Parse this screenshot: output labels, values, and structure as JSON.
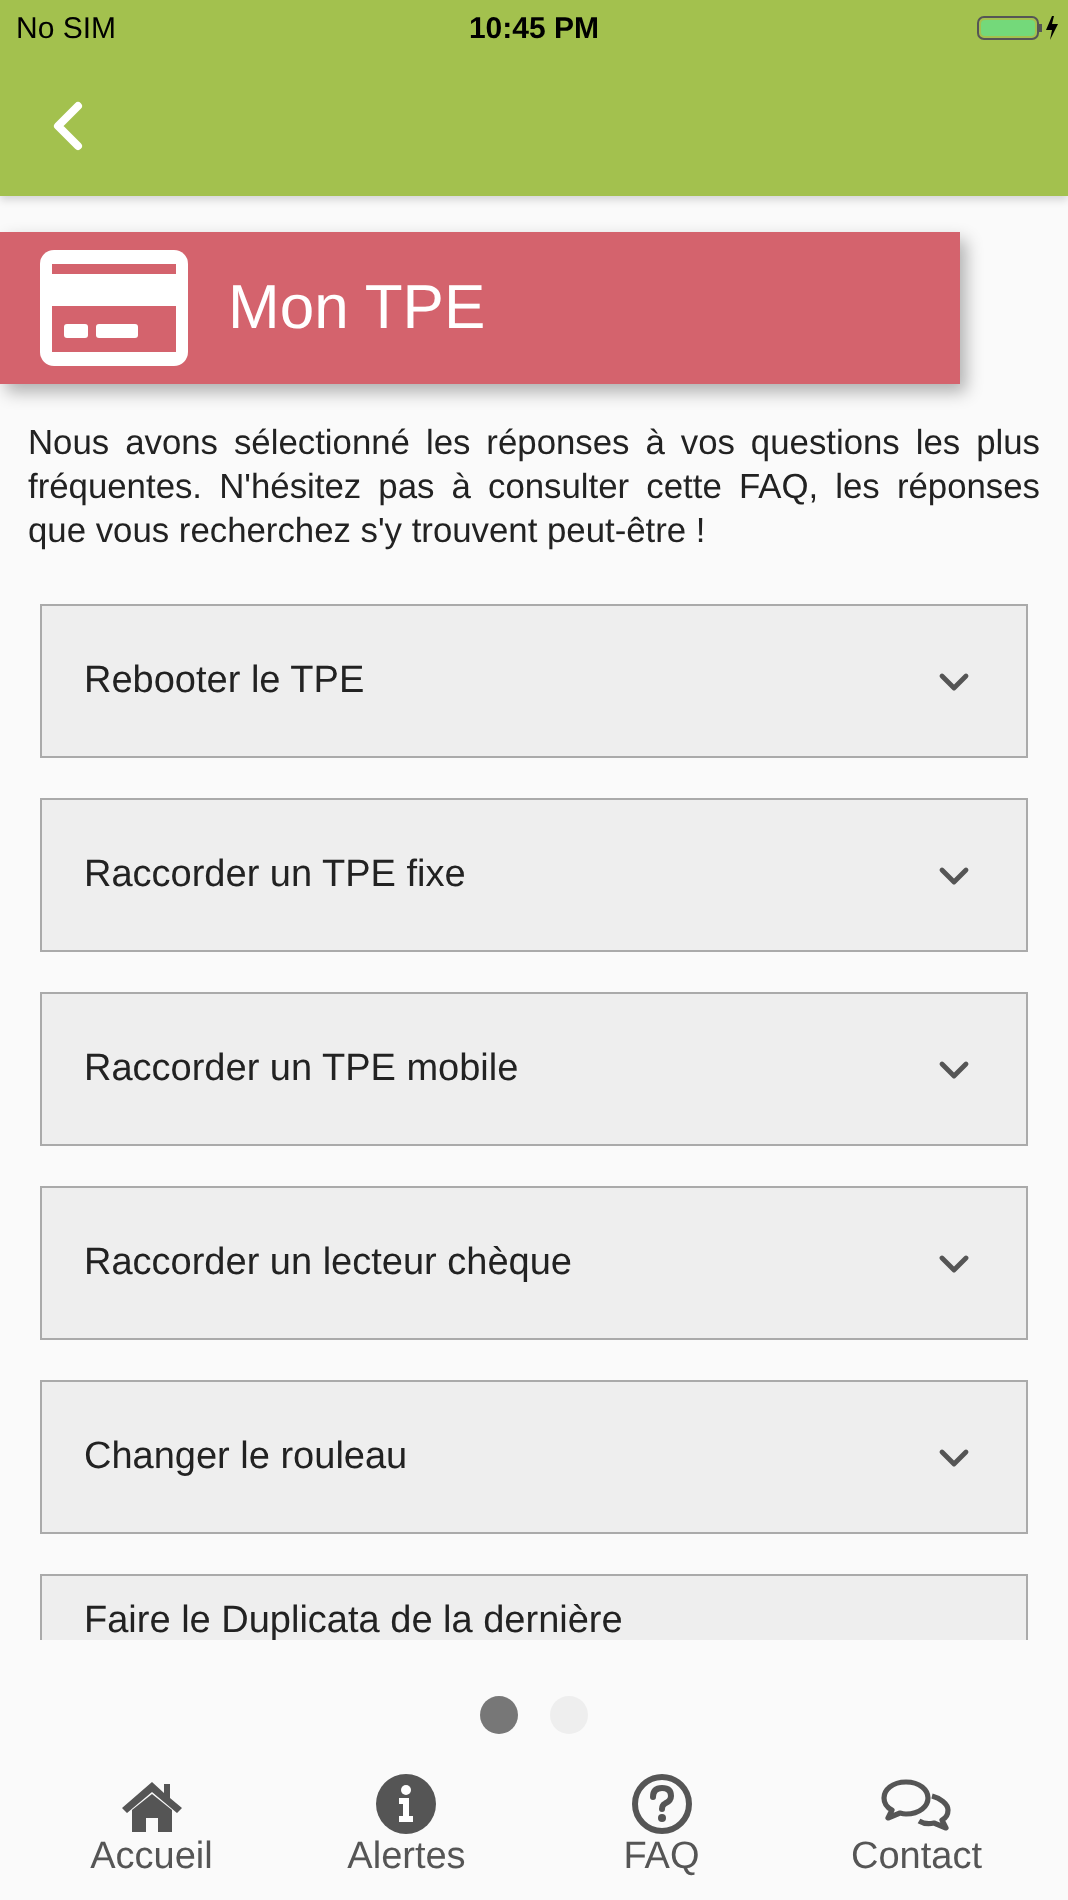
{
  "status_bar": {
    "carrier": "No SIM",
    "time": "10:45 PM"
  },
  "banner": {
    "title": "Mon TPE"
  },
  "intro": "Nous avons sélectionné les réponses à vos questions les plus fréquentes. N'hésitez pas à consulter cette FAQ, les réponses que vous recherchez s'y trouvent peut-être !",
  "faq": [
    {
      "question": "Rebooter le TPE",
      "expanded": false
    },
    {
      "question": "Raccorder un TPE fixe",
      "expanded": false
    },
    {
      "question": "Raccorder un TPE mobile",
      "expanded": false
    },
    {
      "question": "Raccorder un lecteur chèque",
      "expanded": false
    },
    {
      "question": "Changer le rouleau",
      "expanded": false
    },
    {
      "question": "Faire le Duplicata de la dernière",
      "expanded": false
    }
  ],
  "pages": [
    {
      "selected": true
    },
    {
      "selected": false
    }
  ],
  "tab_bar": [
    {
      "kind": "home",
      "label": "Accueil"
    },
    {
      "kind": "info",
      "label": "Alertes"
    },
    {
      "kind": "question",
      "label": "FAQ"
    },
    {
      "kind": "chat",
      "label": "Contact"
    }
  ]
}
